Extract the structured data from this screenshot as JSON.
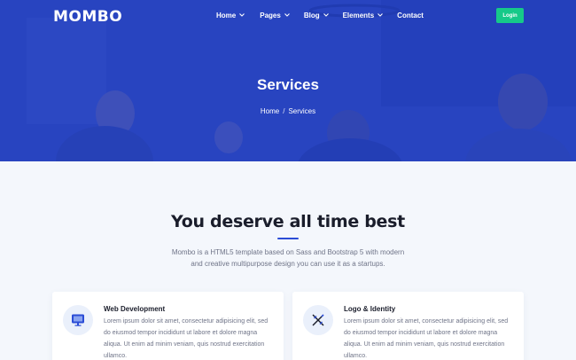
{
  "header": {
    "logo": "MOMBO",
    "nav": [
      {
        "label": "Home",
        "has_dropdown": true
      },
      {
        "label": "Pages",
        "has_dropdown": true
      },
      {
        "label": "Blog",
        "has_dropdown": true
      },
      {
        "label": "Elements",
        "has_dropdown": true
      },
      {
        "label": "Contact",
        "has_dropdown": false
      }
    ],
    "login_label": "Login"
  },
  "hero": {
    "title": "Services",
    "breadcrumb": {
      "home": "Home",
      "separator": "/",
      "current": "Services"
    }
  },
  "main": {
    "title": "You deserve all time best",
    "description": "Mombo is a HTML5 template based on Sass and Bootstrap 5 with modern and creative multipurpose design you can use it as a startups.",
    "services": [
      {
        "title": "Web Development",
        "icon": "monitor-icon",
        "text": "Lorem ipsum dolor sit amet, consectetur adipisicing elit, sed do eiusmod tempor incididunt ut labore et dolore magna aliqua. Ut enim ad minim veniam, quis nostrud exercitation ullamco."
      },
      {
        "title": "Logo & Identity",
        "icon": "design-tools-icon",
        "text": "Lorem ipsum dolor sit amet, consectetur adipisicing elit, sed do eiusmod tempor incididunt ut labore et dolore magna aliqua. Ut enim ad minim veniam, quis nostrud exercitation ullamco."
      }
    ]
  },
  "colors": {
    "hero_overlay": "#2140cd",
    "accent": "#2b4cd6",
    "login_button": "#16c989",
    "page_background": "#f4f7fc"
  }
}
